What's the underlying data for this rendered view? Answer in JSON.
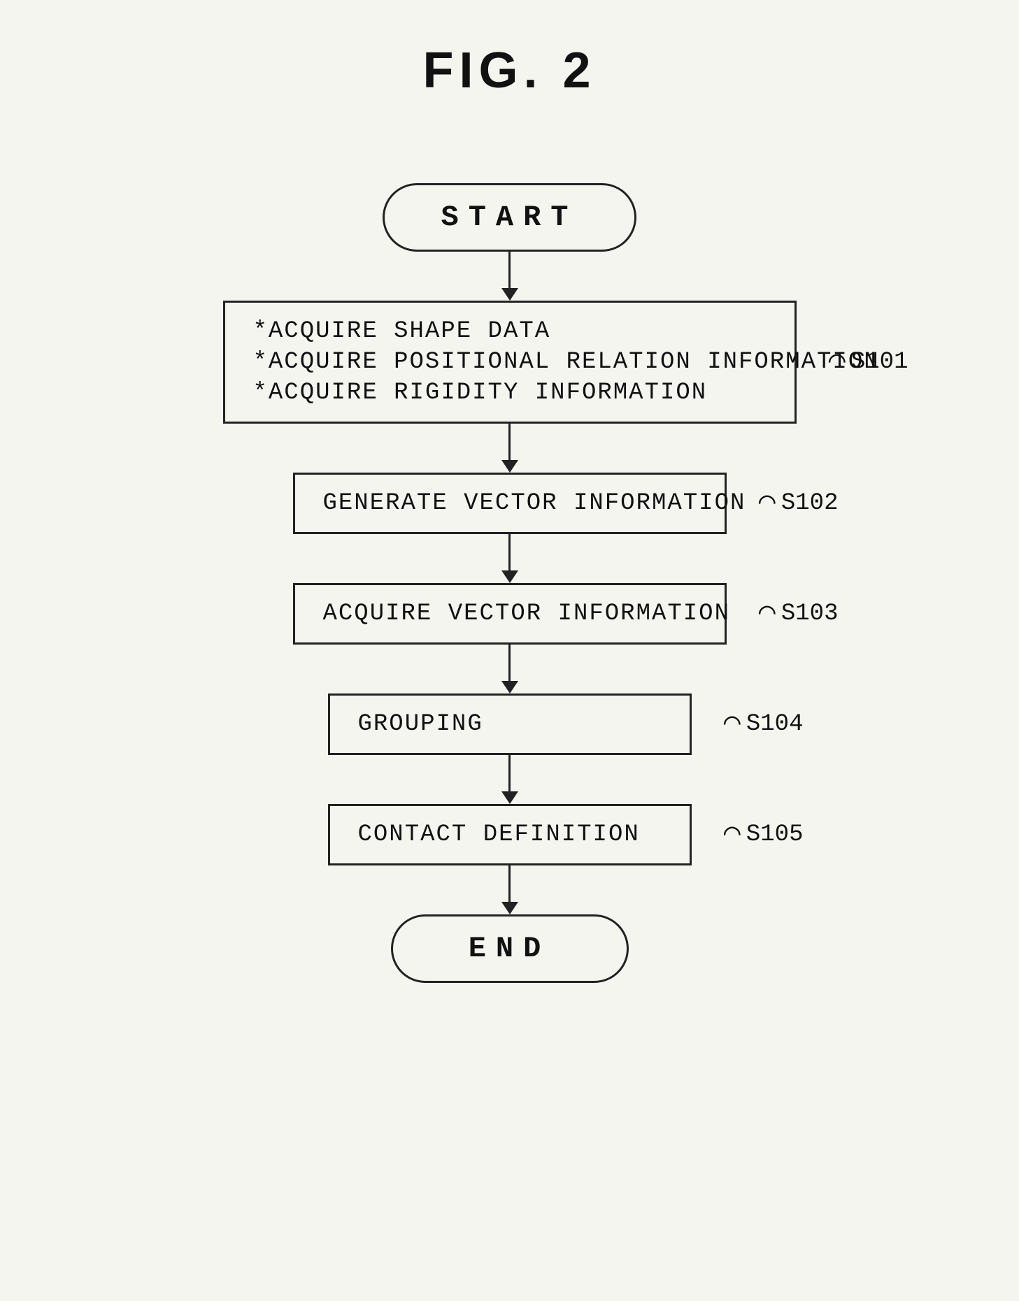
{
  "figure": {
    "title": "FIG. 2"
  },
  "flowchart": {
    "start_label": "START",
    "end_label": "END",
    "steps": [
      {
        "id": "s101",
        "label": "S101",
        "lines": [
          "*ACQUIRE SHAPE DATA",
          "*ACQUIRE POSITIONAL RELATION INFORMATION",
          "*ACQUIRE RIGIDITY INFORMATION"
        ],
        "type": "wide-rect"
      },
      {
        "id": "s102",
        "label": "S102",
        "lines": [
          "GENERATE VECTOR INFORMATION"
        ],
        "type": "medium-rect"
      },
      {
        "id": "s103",
        "label": "S103",
        "lines": [
          "ACQUIRE VECTOR INFORMATION"
        ],
        "type": "medium-rect"
      },
      {
        "id": "s104",
        "label": "S104",
        "lines": [
          "GROUPING"
        ],
        "type": "small-rect"
      },
      {
        "id": "s105",
        "label": "S105",
        "lines": [
          "CONTACT DEFINITION"
        ],
        "type": "small-rect"
      }
    ]
  }
}
